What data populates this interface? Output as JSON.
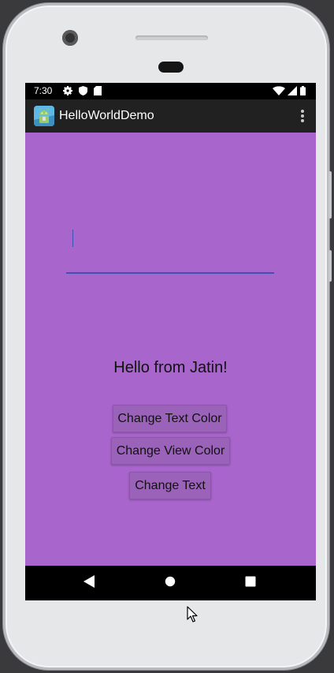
{
  "status_bar": {
    "time": "7:30",
    "left_icons": [
      "gear-icon",
      "shield-icon",
      "sd-card-icon"
    ],
    "right_icons": [
      "wifi-icon",
      "signal-icon",
      "battery-icon"
    ]
  },
  "app_bar": {
    "title": "HelloWorldDemo",
    "icon": "android-app-icon",
    "menu_icon": "overflow-menu-icon"
  },
  "main": {
    "input_value": "",
    "message": "Hello from Jatin!",
    "buttons": [
      {
        "label": "Change Text Color"
      },
      {
        "label": "Change View Color"
      },
      {
        "label": "Change Text"
      }
    ]
  },
  "nav_bar": {
    "icons": [
      "back-icon",
      "home-icon",
      "recents-icon"
    ]
  },
  "colors": {
    "background": "#a865cc",
    "app_bar": "#212121",
    "button": "#9a62b9",
    "input_underline": "#3f51b5"
  }
}
